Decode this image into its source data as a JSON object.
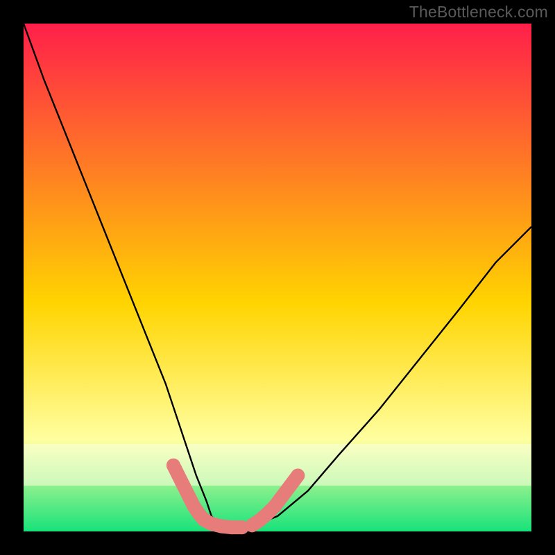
{
  "watermark": "TheBottleneck.com",
  "colors": {
    "page_bg": "#000000",
    "gradient_top": "#ff1f4a",
    "gradient_mid": "#ffd400",
    "gradient_band_light": "#ffffa0",
    "gradient_green": "#18e27a",
    "curve_stroke": "#000000",
    "marker_fill": "#e77d7b"
  },
  "chart_data": {
    "type": "line",
    "title": "",
    "xlabel": "",
    "ylabel": "",
    "xlim": [
      0,
      100
    ],
    "ylim": [
      0,
      100
    ],
    "legend": false,
    "notes": "Bottleneck-style V-curve plotted over a vertical red→yellow→green gradient. Axes are unlabeled; values are approximate positions within the plot area (0=left/bottom, 100=right/top).",
    "series": [
      {
        "name": "bottleneck-curve",
        "x": [
          0,
          4,
          8,
          12,
          16,
          20,
          24,
          28,
          30,
          32,
          34,
          36,
          37,
          39,
          41,
          45,
          50,
          56,
          62,
          70,
          78,
          86,
          93,
          100
        ],
        "y": [
          100,
          89,
          79,
          69,
          59,
          49,
          39,
          29,
          23,
          17,
          11,
          6,
          3,
          1,
          0.7,
          1,
          3,
          8,
          15,
          24,
          34,
          44,
          53,
          60
        ]
      }
    ],
    "markers": [
      {
        "name": "low-side-cluster",
        "note": "salmon markers along left descending arm near the minimum",
        "points": [
          {
            "x": 29.5,
            "y": 13.0
          },
          {
            "x": 30.5,
            "y": 11.0
          },
          {
            "x": 31.5,
            "y": 9.0
          },
          {
            "x": 32.5,
            "y": 7.0
          },
          {
            "x": 33.5,
            "y": 5.0
          },
          {
            "x": 34.5,
            "y": 3.5
          },
          {
            "x": 35.5,
            "y": 2.3
          },
          {
            "x": 37.0,
            "y": 1.5
          },
          {
            "x": 39.0,
            "y": 1.0
          },
          {
            "x": 41.0,
            "y": 0.8
          },
          {
            "x": 43.0,
            "y": 0.8
          }
        ]
      },
      {
        "name": "high-side-cluster",
        "note": "salmon markers along right ascending arm just past the minimum",
        "points": [
          {
            "x": 45.0,
            "y": 1.2
          },
          {
            "x": 46.5,
            "y": 2.2
          },
          {
            "x": 48.0,
            "y": 3.5
          },
          {
            "x": 49.5,
            "y": 5.0
          },
          {
            "x": 51.0,
            "y": 7.0
          },
          {
            "x": 52.5,
            "y": 9.0
          },
          {
            "x": 54.0,
            "y": 11.0
          }
        ]
      }
    ]
  }
}
